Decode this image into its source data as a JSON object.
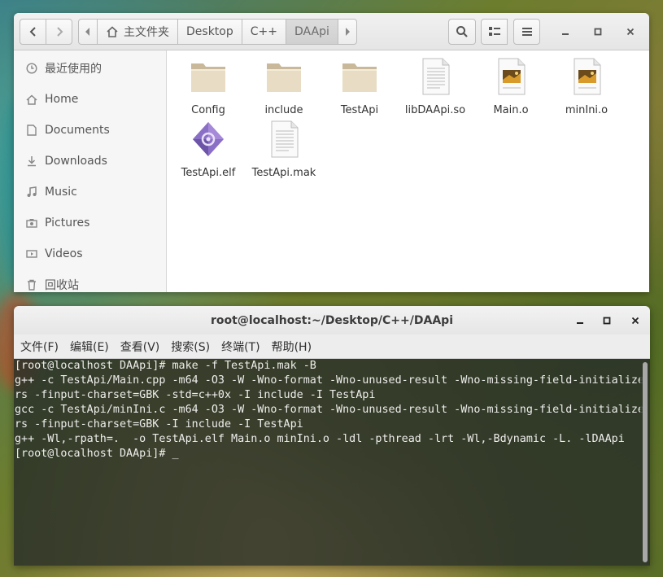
{
  "file_manager": {
    "path": [
      {
        "label": "主文件夹",
        "icon": "home-icon"
      },
      {
        "label": "Desktop"
      },
      {
        "label": "C++"
      },
      {
        "label": "DAApi",
        "active": true
      }
    ],
    "sidebar": [
      {
        "label": "最近使用的",
        "icon": "clock-icon"
      },
      {
        "label": "Home",
        "icon": "home-icon"
      },
      {
        "label": "Documents",
        "icon": "document-icon"
      },
      {
        "label": "Downloads",
        "icon": "download-icon"
      },
      {
        "label": "Music",
        "icon": "music-icon"
      },
      {
        "label": "Pictures",
        "icon": "camera-icon"
      },
      {
        "label": "Videos",
        "icon": "video-icon"
      },
      {
        "label": "回收站",
        "icon": "trash-icon"
      }
    ],
    "files": [
      {
        "name": "Config",
        "type": "folder"
      },
      {
        "name": "include",
        "type": "folder"
      },
      {
        "name": "TestApi",
        "type": "folder"
      },
      {
        "name": "libDAApi.so",
        "type": "text"
      },
      {
        "name": "Main.o",
        "type": "image-doc"
      },
      {
        "name": "minIni.o",
        "type": "image-doc"
      },
      {
        "name": "TestApi.elf",
        "type": "executable"
      },
      {
        "name": "TestApi.mak",
        "type": "text"
      }
    ]
  },
  "terminal": {
    "title": "root@localhost:~/Desktop/C++/DAApi",
    "menu": [
      "文件(F)",
      "编辑(E)",
      "查看(V)",
      "搜索(S)",
      "终端(T)",
      "帮助(H)"
    ],
    "lines": [
      "[root@localhost DAApi]# make -f TestApi.mak -B",
      "g++ -c TestApi/Main.cpp -m64 -O3 -W -Wno-format -Wno-unused-result -Wno-missing-field-initialize",
      "rs -finput-charset=GBK -std=c++0x -I include -I TestApi",
      "gcc -c TestApi/minIni.c -m64 -O3 -W -Wno-format -Wno-unused-result -Wno-missing-field-initialize",
      "rs -finput-charset=GBK -I include -I TestApi",
      "g++ -Wl,-rpath=.  -o TestApi.elf Main.o minIni.o -ldl -pthread -lrt -Wl,-Bdynamic -L. -lDAApi",
      "[root@localhost DAApi]# _"
    ]
  }
}
